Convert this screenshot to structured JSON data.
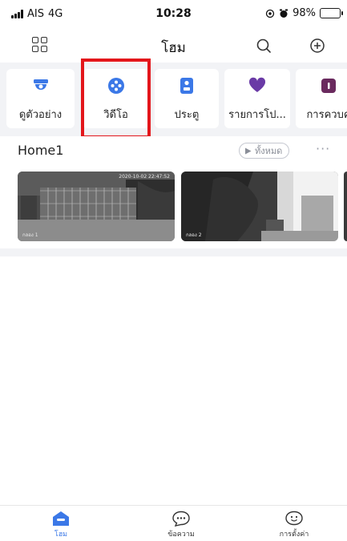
{
  "status_bar": {
    "carrier": "AIS",
    "network": "4G",
    "time": "10:28",
    "battery": "98%",
    "icons": [
      "signal-icon",
      "location-icon",
      "alarm-icon",
      "battery-charging-icon"
    ]
  },
  "header": {
    "title": "โฮม",
    "icons": [
      "grid-menu-icon",
      "search-icon",
      "add-circle-icon"
    ]
  },
  "shortcuts": [
    {
      "label": "ดูตัวอย่าง",
      "icon": "camera-preview-icon",
      "color": "#3b78e7"
    },
    {
      "label": "วิดีโอ",
      "icon": "video-reel-icon",
      "color": "#3b78e7"
    },
    {
      "label": "ประตู",
      "icon": "door-intercom-icon",
      "color": "#3b78e7"
    },
    {
      "label": "รายการโป...",
      "icon": "heart-icon",
      "color": "#6a3aa6"
    },
    {
      "label": "การควบคุ",
      "icon": "control-icon",
      "color": "#6a2a5e"
    }
  ],
  "home": {
    "group_title": "Home1",
    "all_label": "ทั้งหมด",
    "more_label": "···",
    "cameras": [
      {
        "label": "กลอง 1",
        "stamp": "2020-10-02 22:47:52"
      },
      {
        "label": "กลอง 2",
        "stamp": ""
      }
    ]
  },
  "bottom_nav": [
    {
      "label": "โฮม",
      "icon": "home-icon",
      "active": true
    },
    {
      "label": "ข้อความ",
      "icon": "message-icon",
      "active": false
    },
    {
      "label": "การตั้งค่า",
      "icon": "settings-face-icon",
      "active": false
    }
  ],
  "colors": {
    "accent": "#3b78e7",
    "highlight_border": "#e3161b",
    "section_background": "#f2f3f6"
  }
}
